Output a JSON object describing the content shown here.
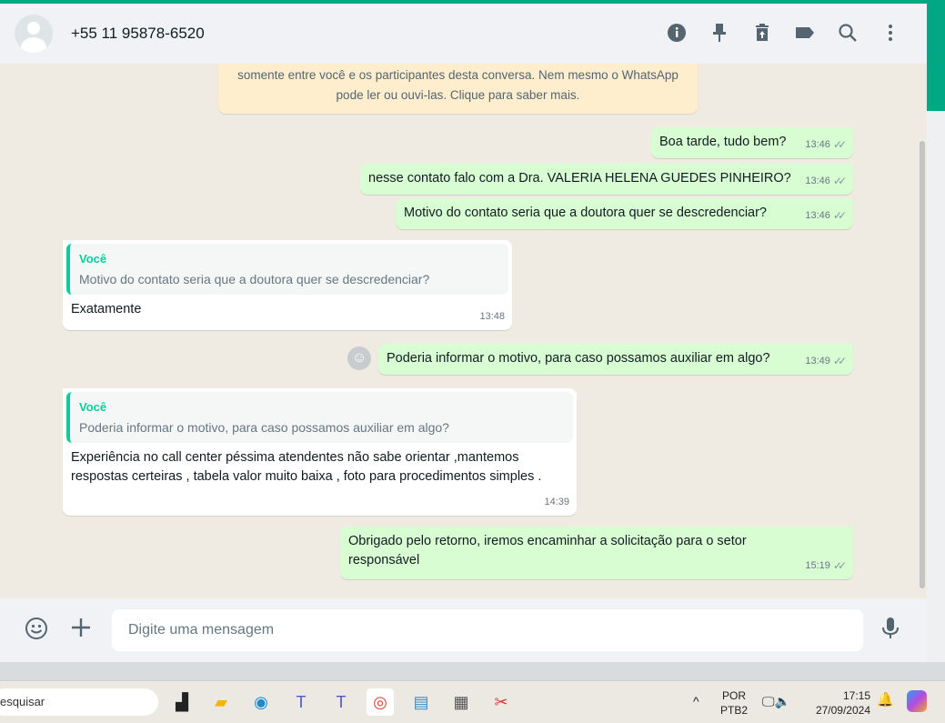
{
  "header": {
    "contact": "+55 11 95878-6520"
  },
  "notice": {
    "line1": "somente entre você e os participantes desta conversa. Nem mesmo o WhatsApp",
    "line2": "pode ler ou ouvi-las. Clique para saber mais."
  },
  "messages": [
    {
      "text": "Boa tarde, tudo bem?",
      "time": "13:46"
    },
    {
      "text": "nesse contato falo com a Dra. VALERIA HELENA GUEDES PINHEIRO?",
      "time": "13:46"
    },
    {
      "text": "Motivo do contato seria que a doutora quer se descredenciar?",
      "time": "13:46"
    },
    {
      "quote_name": "Você",
      "quote_text": "Motivo do contato seria que a doutora quer se descredenciar?",
      "text": "Exatamente",
      "time": "13:48"
    },
    {
      "text": "Poderia informar o motivo, para caso possamos auxiliar em algo?",
      "time": "13:49"
    },
    {
      "quote_name": "Você",
      "quote_text": "Poderia informar o motivo, para caso possamos auxiliar em algo?",
      "text": "Experiência no call center péssima atendentes não sabe orientar ,mantemos respostas certeiras , tabela valor muito baixa ,  foto para procedimentos simples .",
      "time": "14:39"
    },
    {
      "text": "Obrigado pelo retorno, iremos encaminhar a solicitação para o setor responsável",
      "time": "15:19"
    }
  ],
  "footer": {
    "placeholder": "Digite uma mensagem"
  },
  "taskbar": {
    "search": "esquisar",
    "lang1": "POR",
    "lang2": "PTB2",
    "time": "17:15",
    "date": "27/09/2024"
  }
}
